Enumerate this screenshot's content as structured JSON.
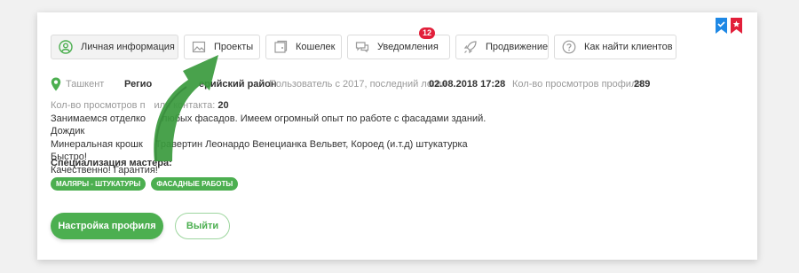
{
  "tabs": [
    {
      "label": "Личная информация",
      "icon": "user-circle-icon"
    },
    {
      "label": "Проекты",
      "icon": "image-icon"
    },
    {
      "label": "Кошелек",
      "icon": "wallet-icon"
    },
    {
      "label": "Уведомления",
      "icon": "chat-icon",
      "badge": "12"
    },
    {
      "label": "Продвижение",
      "icon": "rocket-icon"
    },
    {
      "label": "Как найти клиентов",
      "icon": "question-icon"
    }
  ],
  "profile": {
    "city": "Ташкент",
    "region_label": "Регио",
    "region_value": "ерийский район",
    "user_since": "Пользователь с 2017, последний логин",
    "last_login": "02.08.2018 17:28",
    "profile_views_label": "Кол-во просмотров профиля:",
    "profile_views": "289",
    "contact_views_label": "Кол-во просмотров п",
    "contact_views_label_tail": "иля контакта:",
    "contact_views": "20",
    "description_line1": "Занимаемся отделко",
    "description_line1_tail": "любых фасадов. Имеем огромный опыт по работе с фасадами зданий. Дождик",
    "description_line2": "Минеральная крошк",
    "description_line2_tail": "Травертин Леонардо Венецианка Вельвет, Короед (и.т.д) штукатурка Быстро!",
    "description_line3": "Качественно! Гарантия!"
  },
  "specialization": {
    "title": "Специализация мастера:",
    "tags": [
      "МАЛЯРЫ - ШТУКАТУРЫ",
      "ФАСАДНЫЕ РАБОТЫ"
    ]
  },
  "actions": {
    "settings_label": "Настройка профиля",
    "logout_label": "Выйти"
  },
  "colors": {
    "accent": "#4caf50",
    "badge": "#e21f3a",
    "bookmark_blue": "#1e88e5",
    "bookmark_red": "#e21f3a"
  }
}
